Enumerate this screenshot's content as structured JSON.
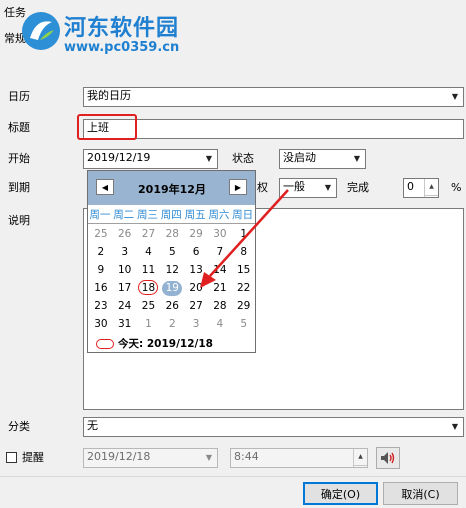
{
  "window": {
    "title": "任务",
    "tab": "常规"
  },
  "watermark": {
    "name": "河东软件园",
    "url": "www.pc0359.cn"
  },
  "form": {
    "calendar_label": "日历",
    "calendar_value": "我的日历",
    "title_label": "标题",
    "title_value": "上班",
    "start_label": "开始",
    "start_value": "2019/12/19",
    "status_label": "状态",
    "status_value": "没启动",
    "due_label": "到期",
    "priority_label": "权",
    "priority_value": "一般",
    "complete_label": "完成",
    "complete_value": "0",
    "percent": "%",
    "note_label": "说明",
    "category_label": "分类",
    "category_value": "无",
    "reminder_label": "提醒",
    "reminder_date": "2019/12/18",
    "reminder_time": "8:44"
  },
  "calendar_popup": {
    "title": "2019年12月",
    "weekdays": [
      "周一",
      "周二",
      "周三",
      "周四",
      "周五",
      "周六",
      "周日"
    ],
    "weeks": [
      [
        "25",
        "26",
        "27",
        "28",
        "29",
        "30",
        "1"
      ],
      [
        "2",
        "3",
        "4",
        "5",
        "6",
        "7",
        "8"
      ],
      [
        "9",
        "10",
        "11",
        "12",
        "13",
        "14",
        "15"
      ],
      [
        "16",
        "17",
        "18",
        "19",
        "20",
        "21",
        "22"
      ],
      [
        "23",
        "24",
        "25",
        "26",
        "27",
        "28",
        "29"
      ],
      [
        "30",
        "31",
        "1",
        "2",
        "3",
        "4",
        "5"
      ]
    ],
    "selected": "19",
    "today": "18",
    "today_text": "今天: 2019/12/18"
  },
  "buttons": {
    "ok": "确定(O)",
    "cancel": "取消(C)"
  },
  "colors": {
    "annotation": "#e02020",
    "header": "#99b4d1",
    "weekday": "#2e8ad3"
  }
}
